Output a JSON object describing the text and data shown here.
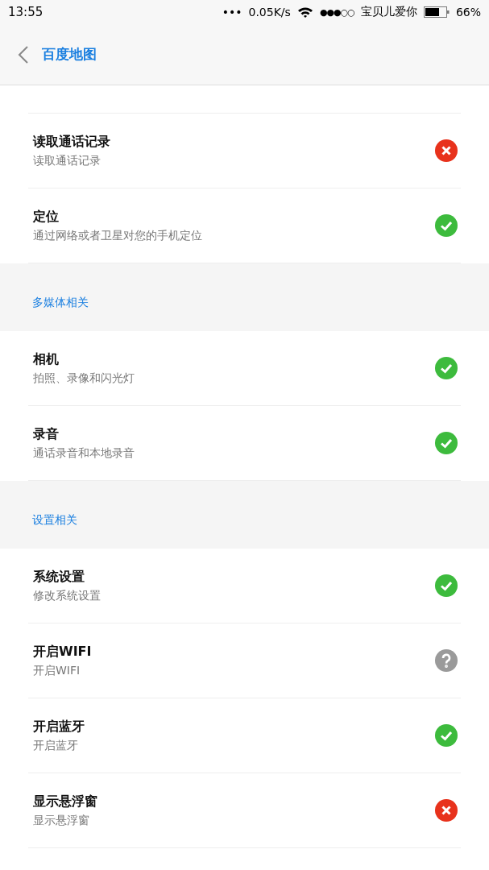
{
  "status_bar": {
    "time": "13:55",
    "dots": "•••",
    "speed": "0.05K/s",
    "signal_dots": "●●●○○",
    "carrier": "宝贝儿爱你",
    "battery": "66%"
  },
  "header": {
    "title": "百度地图"
  },
  "sections": [
    {
      "items": [
        {
          "name": "读取通话记录",
          "desc": "读取通话记录",
          "kind": "denied"
        },
        {
          "name": "定位",
          "desc": "通过网络或者卫星对您的手机定位",
          "kind": "granted"
        }
      ]
    },
    {
      "title": "多媒体相关",
      "items": [
        {
          "name": "相机",
          "desc": "拍照、录像和闪光灯",
          "kind": "granted"
        },
        {
          "name": "录音",
          "desc": "通话录音和本地录音",
          "kind": "granted"
        }
      ]
    },
    {
      "title": "设置相关",
      "items": [
        {
          "name": "系统设置",
          "desc": "修改系统设置",
          "kind": "granted"
        },
        {
          "name": "开启WIFI",
          "desc": "开启WIFI",
          "kind": "ask"
        },
        {
          "name": "开启蓝牙",
          "desc": "开启蓝牙",
          "kind": "granted"
        },
        {
          "name": "显示悬浮窗",
          "desc": "显示悬浮窗",
          "kind": "denied"
        }
      ]
    }
  ]
}
